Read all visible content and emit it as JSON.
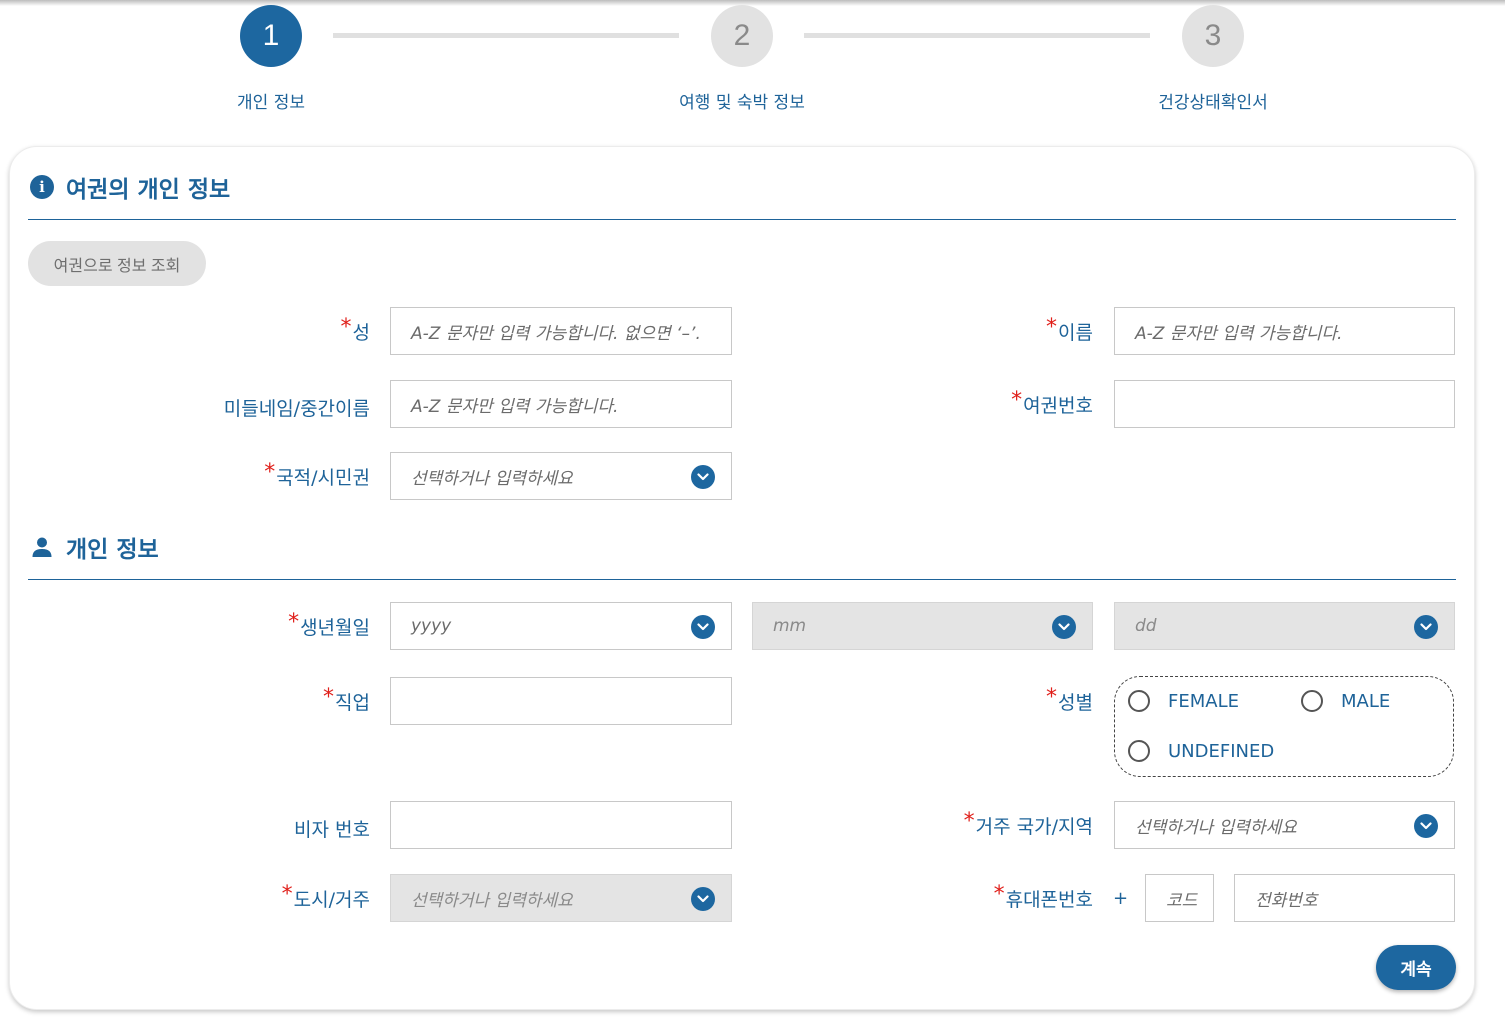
{
  "stepper": {
    "steps": [
      {
        "number": "1",
        "label": "개인 정보"
      },
      {
        "number": "2",
        "label": "여행 및 숙박 정보"
      },
      {
        "number": "3",
        "label": "건강상태확인서"
      }
    ]
  },
  "passport_section": {
    "title": "여권의 개인 정보",
    "lookup_button": "여권으로 정보 조회",
    "fields": {
      "surname": {
        "label": "성",
        "required": "*",
        "placeholder": "A-Z 문자만 입력 가능합니다. 없으면 ‘–’."
      },
      "given_name": {
        "label": "이름",
        "required": "*",
        "placeholder": "A-Z 문자만 입력 가능합니다."
      },
      "middle_name": {
        "label": "미들네임/중간이름",
        "placeholder": "A-Z 문자만 입력 가능합니다."
      },
      "passport_no": {
        "label": "여권번호",
        "required": "*",
        "placeholder": ""
      },
      "nationality": {
        "label": "국적/시민권",
        "required": "*",
        "placeholder": "선택하거나 입력하세요"
      }
    }
  },
  "personal_section": {
    "title": "개인 정보",
    "fields": {
      "birth_date": {
        "label": "생년월일",
        "required": "*",
        "year": "yyyy",
        "month": "mm",
        "day": "dd"
      },
      "occupation": {
        "label": "직업",
        "required": "*"
      },
      "gender": {
        "label": "성별",
        "required": "*",
        "options": [
          "FEMALE",
          "MALE",
          "UNDEFINED"
        ]
      },
      "visa_no": {
        "label": "비자 번호"
      },
      "country": {
        "label": "거주 국가/지역",
        "required": "*",
        "placeholder": "선택하거나 입력하세요"
      },
      "city": {
        "label": "도시/거주",
        "required": "*",
        "placeholder": "선택하거나 입력하세요"
      },
      "phone": {
        "label": "휴대폰번호",
        "required": "*",
        "prefix": "+",
        "code_placeholder": "코드",
        "number_placeholder": "전화번호"
      }
    }
  },
  "continue_button": "계속",
  "colors": {
    "accent": "#1d67a0",
    "required": "#e0201b",
    "disabled": "#e4e4e4"
  }
}
